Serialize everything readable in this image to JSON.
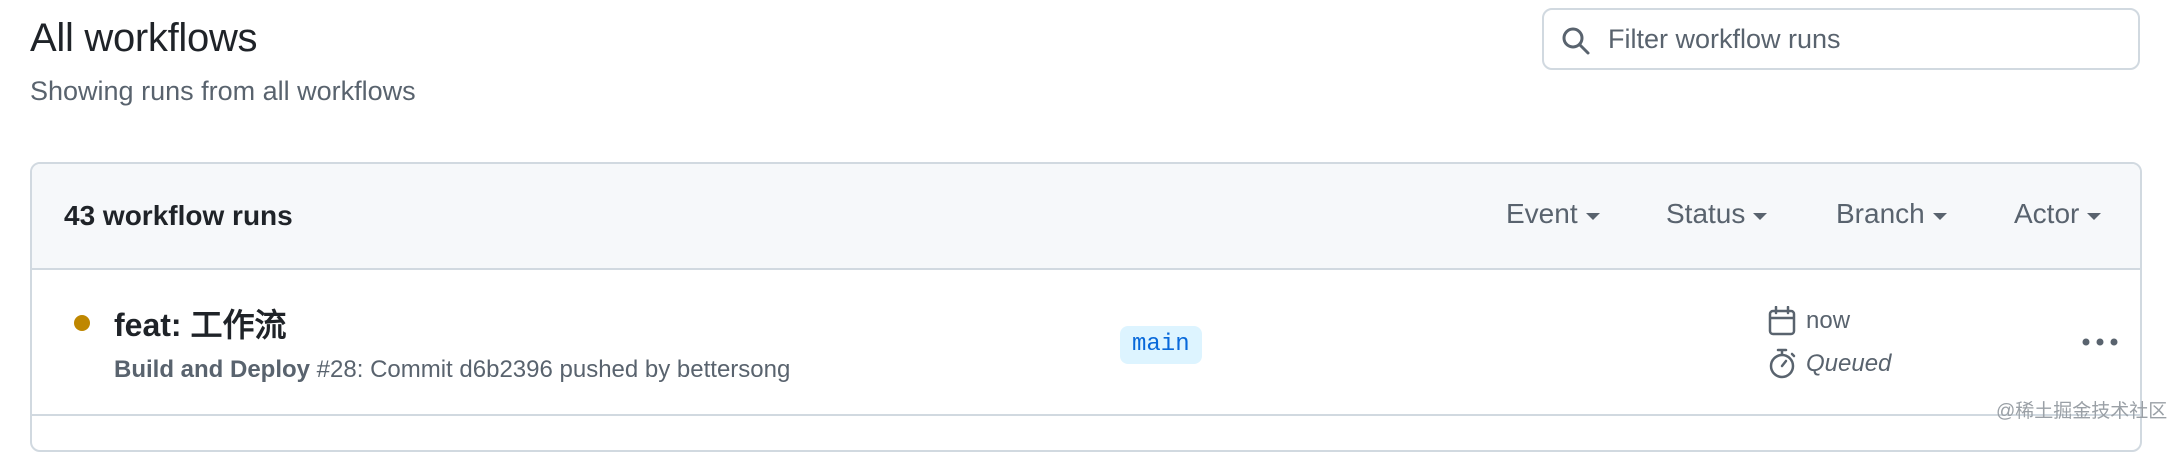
{
  "header": {
    "title": "All workflows",
    "subtitle": "Showing runs from all workflows"
  },
  "search": {
    "placeholder": "Filter workflow runs",
    "icon": "search-icon"
  },
  "runs": {
    "count_label": "43 workflow runs",
    "filters": [
      {
        "label": "Event",
        "icon": "caret-down-icon"
      },
      {
        "label": "Status",
        "icon": "caret-down-icon"
      },
      {
        "label": "Branch",
        "icon": "caret-down-icon"
      },
      {
        "label": "Actor",
        "icon": "caret-down-icon"
      }
    ],
    "items": [
      {
        "status_color": "#bf8700",
        "title": "feat: 工作流",
        "workflow": "Build and Deploy",
        "details": " #28: Commit d6b2396 pushed by bettersong",
        "branch": "main",
        "time": "now",
        "time_icon": "calendar-icon",
        "state": "Queued",
        "state_icon": "stopwatch-icon",
        "more_icon": "kebab-horizontal-icon"
      }
    ]
  },
  "watermark": "@稀土掘金技术社区",
  "colors": {
    "text": "#1f2328",
    "muted": "#59636e",
    "border": "#d1d9e0",
    "header_bg": "#f6f8fa",
    "queued": "#bf8700",
    "branch_bg": "#ddf4ff",
    "branch_text": "#0969da"
  }
}
